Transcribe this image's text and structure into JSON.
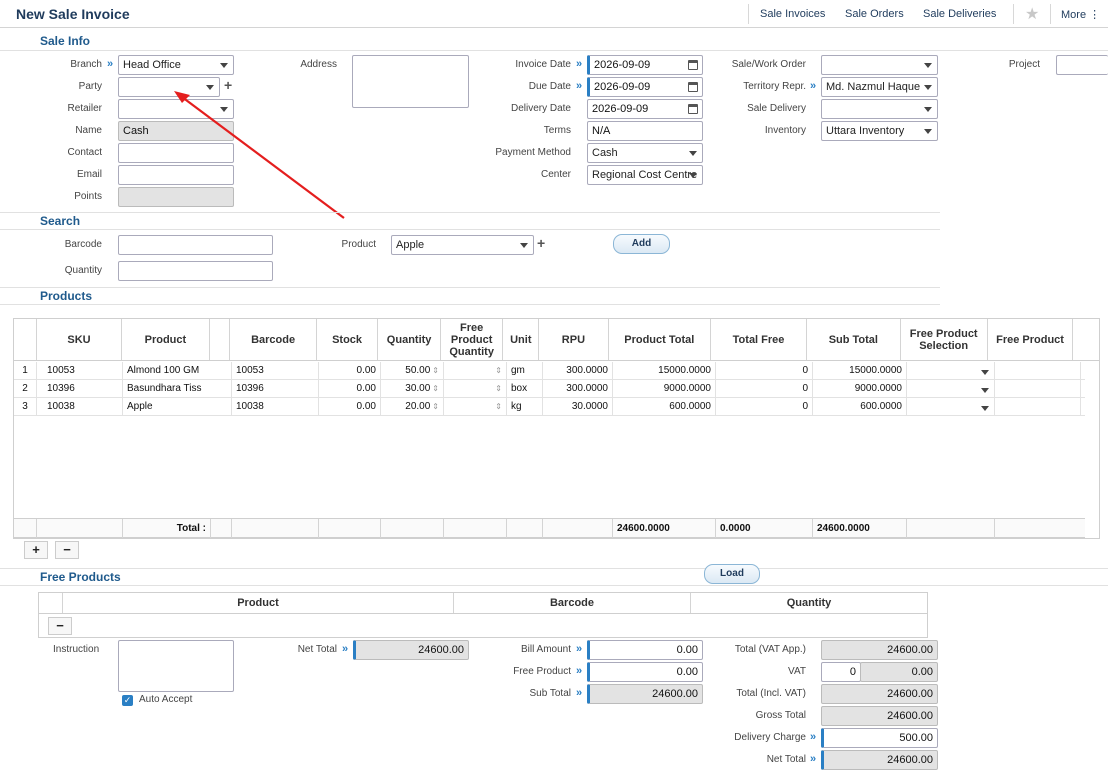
{
  "header": {
    "title": "New Sale Invoice",
    "nav": [
      "Sale Invoices",
      "Sale Orders",
      "Sale Deliveries"
    ],
    "more": "More"
  },
  "sale_info": {
    "section": "Sale Info",
    "branch": {
      "label": "Branch",
      "value": "Head Office"
    },
    "party": {
      "label": "Party",
      "value": ""
    },
    "retailer": {
      "label": "Retailer",
      "value": ""
    },
    "name": {
      "label": "Name",
      "value": "Cash"
    },
    "contact": {
      "label": "Contact",
      "value": ""
    },
    "email": {
      "label": "Email",
      "value": ""
    },
    "points": {
      "label": "Points",
      "value": ""
    },
    "address": {
      "label": "Address",
      "value": ""
    },
    "invoice_date": {
      "label": "Invoice Date",
      "value": "2026-09-09"
    },
    "due_date": {
      "label": "Due Date",
      "value": "2026-09-09"
    },
    "delivery_date": {
      "label": "Delivery Date",
      "value": "2026-09-09"
    },
    "terms": {
      "label": "Terms",
      "value": "N/A"
    },
    "payment_method": {
      "label": "Payment Method",
      "value": "Cash"
    },
    "center": {
      "label": "Center",
      "value": "Regional Cost Centre"
    },
    "sale_work_order": {
      "label": "Sale/Work Order",
      "value": ""
    },
    "territory": {
      "label": "Territory Repr.",
      "value": "Md. Nazmul Haque"
    },
    "sale_delivery": {
      "label": "Sale Delivery",
      "value": ""
    },
    "inventory": {
      "label": "Inventory",
      "value": "Uttara Inventory"
    },
    "project": {
      "label": "Project",
      "value": ""
    }
  },
  "search": {
    "section": "Search",
    "barcode": {
      "label": "Barcode",
      "value": ""
    },
    "quantity": {
      "label": "Quantity",
      "value": ""
    },
    "product": {
      "label": "Product",
      "value": "Apple"
    },
    "add": "Add"
  },
  "products": {
    "section": "Products",
    "columns": [
      "SKU",
      "Product",
      "Barcode",
      "Stock",
      "Quantity",
      "Free Product Quantity",
      "Unit",
      "RPU",
      "Product Total",
      "Total Free",
      "Sub Total",
      "Free Product Selection",
      "Free Product"
    ],
    "rows": [
      {
        "n": "1",
        "sku": "10053",
        "product": "Almond 100 GM",
        "barcode": "10053",
        "stock": "0.00",
        "quantity": "50.00",
        "unit": "gm",
        "rpu": "300.0000",
        "product_total": "15000.0000",
        "total_free": "0",
        "sub_total": "15000.0000"
      },
      {
        "n": "2",
        "sku": "10396",
        "product": "Basundhara Tiss",
        "barcode": "10396",
        "stock": "0.00",
        "quantity": "30.00",
        "unit": "box",
        "rpu": "300.0000",
        "product_total": "9000.0000",
        "total_free": "0",
        "sub_total": "9000.0000"
      },
      {
        "n": "3",
        "sku": "10038",
        "product": "Apple",
        "barcode": "10038",
        "stock": "0.00",
        "quantity": "20.00",
        "unit": "kg",
        "rpu": "30.0000",
        "product_total": "600.0000",
        "total_free": "0",
        "sub_total": "600.0000"
      }
    ],
    "total_label": "Total :",
    "total_product": "24600.0000",
    "total_free": "0.0000",
    "total_sub": "24600.0000",
    "add_btn": "+",
    "remove_btn": "−"
  },
  "free_products": {
    "section": "Free Products",
    "load": "Load",
    "columns": [
      "Product",
      "Barcode",
      "Quantity"
    ],
    "remove_btn": "−"
  },
  "summary": {
    "instruction": {
      "label": "Instruction",
      "value": ""
    },
    "auto_accept": "Auto Accept",
    "net_total_left": {
      "label": "Net Total",
      "value": "24600.00"
    },
    "bill_amount": {
      "label": "Bill Amount",
      "value": "0.00"
    },
    "free_product": {
      "label": "Free Product",
      "value": "0.00"
    },
    "sub_total": {
      "label": "Sub Total",
      "value": "24600.00"
    },
    "total_vat_app": {
      "label": "Total (VAT App.)",
      "value": "24600.00"
    },
    "vat": {
      "label": "VAT",
      "percent": "0",
      "value": "0.00"
    },
    "total_incl_vat": {
      "label": "Total (Incl. VAT)",
      "value": "24600.00"
    },
    "gross_total": {
      "label": "Gross Total",
      "value": "24600.00"
    },
    "delivery_charge": {
      "label": "Delivery Charge",
      "value": "500.00"
    },
    "net_total": {
      "label": "Net Total",
      "value": "24600.00"
    }
  }
}
